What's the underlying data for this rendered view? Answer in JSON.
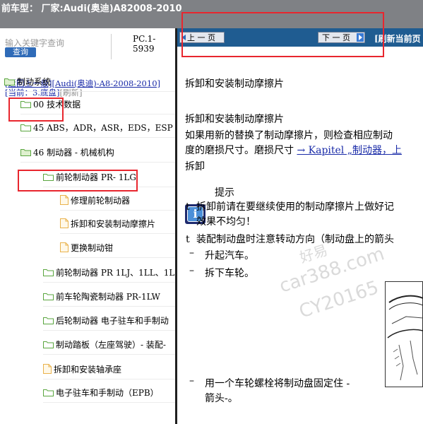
{
  "window": {
    "title": "前车型： 厂家:Audi(奥迪)A82008-2010"
  },
  "sidebar": {
    "search_placeholder": "输入关键字查询",
    "query_button": "查询",
    "pc_code": "PC.1-5939",
    "nav_back": "[返回上一级]",
    "nav_model": "[Audi(奥迪)-A8-2008-2010]",
    "current": "[当前：3.底盘]",
    "refresh": "[刷新]",
    "tree": [
      {
        "label": "制动系统",
        "type": "folder",
        "open": true
      },
      {
        "label": "00 技术数据",
        "type": "folder",
        "open": false
      },
      {
        "label": "45 ABS，ADR，ASR，EDS，ESP",
        "type": "folder",
        "open": false
      },
      {
        "label": "46 制动器 - 机械机构",
        "type": "folder",
        "open": true
      },
      {
        "label": "前轮制动器 PR- 1LG",
        "type": "folder",
        "open": false
      },
      {
        "label": "修理前轮制动器",
        "type": "file"
      },
      {
        "label": "拆卸和安装制动摩擦片",
        "type": "file"
      },
      {
        "label": "更换制动钳",
        "type": "file"
      },
      {
        "label": "前轮制动器 PR 1LJ、1LL、1L",
        "type": "folder",
        "open": false
      },
      {
        "label": "前车轮陶瓷制动器 PR-1LW",
        "type": "folder",
        "open": false
      },
      {
        "label": "后轮制动器 电子驻车和手制动",
        "type": "folder",
        "open": false
      },
      {
        "label": "制动踏板（左座驾驶）- 装配-",
        "type": "folder",
        "open": false
      },
      {
        "label": "拆卸和安装轴承座",
        "type": "file"
      },
      {
        "label": "电子驻车和手制动（EPB）",
        "type": "folder",
        "open": false
      }
    ]
  },
  "toolbar": {
    "prev": "上 一 页",
    "next": "下 一 页",
    "refresh_page": "[刷新当前页"
  },
  "doc": {
    "title": "拆卸和安装制动摩擦片",
    "heading": "拆卸和安装制动摩擦片",
    "p1_line1": "如果用新的替换了制动摩擦片，则检查相应制动",
    "p1_line2_pre": "度的磨损尺寸。磨损尺寸 ",
    "p1_link": "→ Kapitel „制动器，上",
    "removal": "拆卸",
    "note_label": "提示",
    "bullet_mark": "t",
    "b1_line1": "拆卸前请在要继续使用的制动摩擦片上做好记",
    "b1_line2": "效果不均匀！",
    "b2": "装配制动盘时注意转动方向（制动盘上的箭头",
    "dash": "–",
    "s1": "升起汽车。",
    "s2": "拆下车轮。",
    "s3_line1": "用一个车轮螺栓将制动盘固定住 -",
    "s3_line2": "箭头-。"
  },
  "watermark": {
    "brand": "好易",
    "site": "car388.com",
    "code": "CY20165"
  },
  "colors": {
    "titlebar": "#7f8185",
    "toolbar": "#1f5c91",
    "link": "#1a2ba8",
    "annotation": "#e8262e",
    "folder": "#5aa63f",
    "file": "#e9b24c"
  }
}
